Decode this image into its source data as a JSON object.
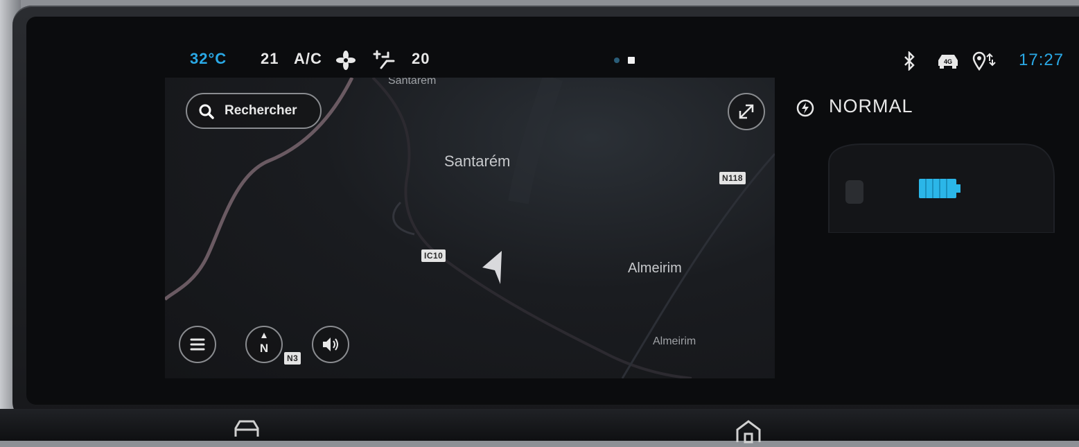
{
  "status_bar": {
    "exterior_temperature": "32°C",
    "temperature_left": "21",
    "ac_label": "A/C",
    "temperature_right": "20",
    "clock": "17:27",
    "icons": [
      "fan-icon",
      "air-flow-seat-icon",
      "bluetooth-icon",
      "car-4g-icon",
      "location-share-icon"
    ]
  },
  "map": {
    "labels": {
      "top_city_partial": "Santarém",
      "city": "Santarém",
      "town": "Almeirim",
      "town_small": "Almeirim"
    },
    "road_badges": {
      "n118": "N118",
      "ic10": "IC10",
      "n3": "N3"
    },
    "search": {
      "label": "Rechercher"
    },
    "controls": [
      "expand-icon",
      "menu-icon",
      "compass-north-icon",
      "volume-icon"
    ]
  },
  "side_panel": {
    "drive_mode": "NORMAL",
    "battery_color": "#2bb6e8"
  },
  "colors": {
    "accent": "#2aa9e6",
    "background": "#0b0c0e"
  }
}
